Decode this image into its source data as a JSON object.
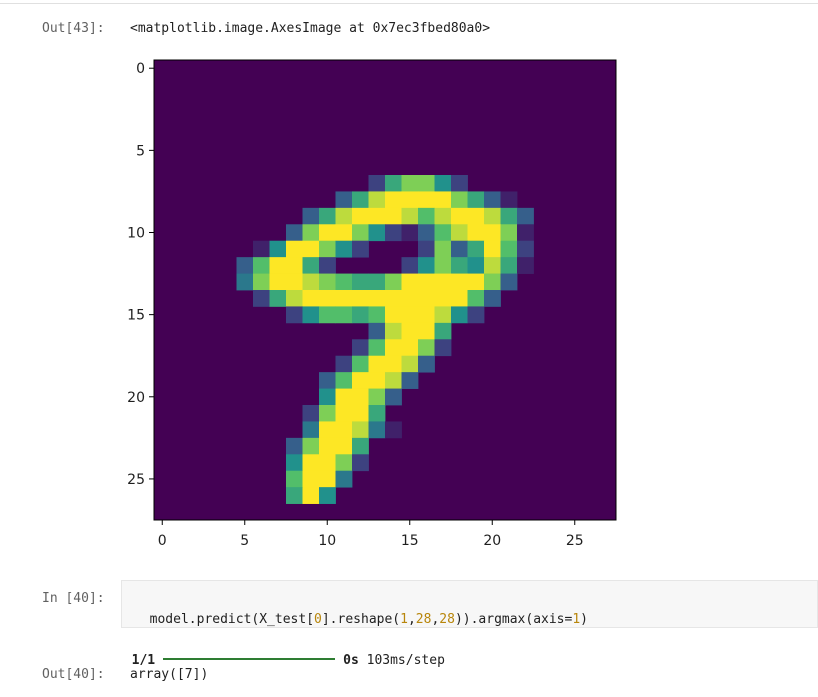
{
  "out43": {
    "prompt": "Out[43]:",
    "text": "<matplotlib.image.AxesImage at 0x7ec3fbed80a0>"
  },
  "chart_data": {
    "type": "heatmap",
    "title": "",
    "xlabel": "",
    "ylabel": "",
    "xlim": [
      -0.5,
      27.5
    ],
    "ylim": [
      27.5,
      -0.5
    ],
    "x_ticks": [
      "0",
      "5",
      "10",
      "15",
      "20",
      "25"
    ],
    "y_ticks": [
      "0",
      "5",
      "10",
      "15",
      "20",
      "25"
    ],
    "colormap": "viridis",
    "background_color": "#440154",
    "digit_pixels": [
      [
        7,
        13,
        0.2
      ],
      [
        7,
        14,
        0.6
      ],
      [
        7,
        15,
        0.8
      ],
      [
        7,
        16,
        0.8
      ],
      [
        7,
        17,
        0.5
      ],
      [
        7,
        18,
        0.2
      ],
      [
        8,
        11,
        0.3
      ],
      [
        8,
        12,
        0.6
      ],
      [
        8,
        13,
        0.9
      ],
      [
        8,
        14,
        1.0
      ],
      [
        8,
        15,
        1.0
      ],
      [
        8,
        16,
        1.0
      ],
      [
        8,
        17,
        1.0
      ],
      [
        8,
        18,
        0.8
      ],
      [
        8,
        19,
        0.6
      ],
      [
        8,
        20,
        0.3
      ],
      [
        8,
        21,
        0.1
      ],
      [
        9,
        9,
        0.3
      ],
      [
        9,
        10,
        0.6
      ],
      [
        9,
        11,
        0.9
      ],
      [
        9,
        12,
        1.0
      ],
      [
        9,
        13,
        1.0
      ],
      [
        9,
        14,
        1.0
      ],
      [
        9,
        15,
        0.9
      ],
      [
        9,
        16,
        0.7
      ],
      [
        9,
        17,
        0.9
      ],
      [
        9,
        18,
        1.0
      ],
      [
        9,
        19,
        1.0
      ],
      [
        9,
        20,
        0.9
      ],
      [
        9,
        21,
        0.6
      ],
      [
        9,
        22,
        0.3
      ],
      [
        10,
        8,
        0.3
      ],
      [
        10,
        9,
        0.8
      ],
      [
        10,
        10,
        1.0
      ],
      [
        10,
        11,
        1.0
      ],
      [
        10,
        12,
        0.8
      ],
      [
        10,
        13,
        0.5
      ],
      [
        10,
        14,
        0.2
      ],
      [
        10,
        15,
        0.1
      ],
      [
        10,
        16,
        0.3
      ],
      [
        10,
        17,
        0.7
      ],
      [
        10,
        18,
        0.9
      ],
      [
        10,
        19,
        1.0
      ],
      [
        10,
        20,
        1.0
      ],
      [
        10,
        21,
        0.8
      ],
      [
        10,
        22,
        0.1
      ],
      [
        11,
        6,
        0.1
      ],
      [
        11,
        7,
        0.5
      ],
      [
        11,
        8,
        1.0
      ],
      [
        11,
        9,
        1.0
      ],
      [
        11,
        10,
        0.8
      ],
      [
        11,
        11,
        0.5
      ],
      [
        11,
        12,
        0.2
      ],
      [
        11,
        16,
        0.2
      ],
      [
        11,
        17,
        0.8
      ],
      [
        11,
        18,
        0.3
      ],
      [
        11,
        19,
        0.6
      ],
      [
        11,
        20,
        1.0
      ],
      [
        11,
        21,
        0.7
      ],
      [
        11,
        22,
        0.2
      ],
      [
        12,
        5,
        0.3
      ],
      [
        12,
        6,
        0.7
      ],
      [
        12,
        7,
        1.0
      ],
      [
        12,
        8,
        1.0
      ],
      [
        12,
        9,
        0.6
      ],
      [
        12,
        10,
        0.2
      ],
      [
        12,
        15,
        0.2
      ],
      [
        12,
        16,
        0.5
      ],
      [
        12,
        17,
        0.8
      ],
      [
        12,
        18,
        0.6
      ],
      [
        12,
        19,
        0.5
      ],
      [
        12,
        20,
        0.9
      ],
      [
        12,
        21,
        0.6
      ],
      [
        12,
        22,
        0.1
      ],
      [
        13,
        5,
        0.4
      ],
      [
        13,
        6,
        0.8
      ],
      [
        13,
        7,
        1.0
      ],
      [
        13,
        8,
        1.0
      ],
      [
        13,
        9,
        0.9
      ],
      [
        13,
        10,
        0.8
      ],
      [
        13,
        11,
        0.7
      ],
      [
        13,
        12,
        0.6
      ],
      [
        13,
        13,
        0.6
      ],
      [
        13,
        14,
        0.8
      ],
      [
        13,
        15,
        1.0
      ],
      [
        13,
        16,
        1.0
      ],
      [
        13,
        17,
        1.0
      ],
      [
        13,
        18,
        1.0
      ],
      [
        13,
        19,
        1.0
      ],
      [
        13,
        20,
        0.8
      ],
      [
        13,
        21,
        0.3
      ],
      [
        14,
        6,
        0.2
      ],
      [
        14,
        7,
        0.6
      ],
      [
        14,
        8,
        0.9
      ],
      [
        14,
        9,
        1.0
      ],
      [
        14,
        10,
        1.0
      ],
      [
        14,
        11,
        1.0
      ],
      [
        14,
        12,
        1.0
      ],
      [
        14,
        13,
        1.0
      ],
      [
        14,
        14,
        1.0
      ],
      [
        14,
        15,
        1.0
      ],
      [
        14,
        16,
        1.0
      ],
      [
        14,
        17,
        1.0
      ],
      [
        14,
        18,
        1.0
      ],
      [
        14,
        19,
        0.7
      ],
      [
        14,
        20,
        0.3
      ],
      [
        15,
        8,
        0.2
      ],
      [
        15,
        9,
        0.5
      ],
      [
        15,
        10,
        0.7
      ],
      [
        15,
        11,
        0.7
      ],
      [
        15,
        12,
        0.6
      ],
      [
        15,
        13,
        0.7
      ],
      [
        15,
        14,
        1.0
      ],
      [
        15,
        15,
        1.0
      ],
      [
        15,
        16,
        1.0
      ],
      [
        15,
        17,
        0.9
      ],
      [
        15,
        18,
        0.5
      ],
      [
        15,
        19,
        0.2
      ],
      [
        16,
        13,
        0.3
      ],
      [
        16,
        14,
        0.9
      ],
      [
        16,
        15,
        1.0
      ],
      [
        16,
        16,
        1.0
      ],
      [
        16,
        17,
        0.6
      ],
      [
        17,
        12,
        0.2
      ],
      [
        17,
        13,
        0.7
      ],
      [
        17,
        14,
        1.0
      ],
      [
        17,
        15,
        1.0
      ],
      [
        17,
        16,
        0.8
      ],
      [
        17,
        17,
        0.2
      ],
      [
        18,
        11,
        0.2
      ],
      [
        18,
        12,
        0.7
      ],
      [
        18,
        13,
        1.0
      ],
      [
        18,
        14,
        1.0
      ],
      [
        18,
        15,
        0.9
      ],
      [
        18,
        16,
        0.3
      ],
      [
        19,
        10,
        0.3
      ],
      [
        19,
        11,
        0.7
      ],
      [
        19,
        12,
        1.0
      ],
      [
        19,
        13,
        1.0
      ],
      [
        19,
        14,
        0.9
      ],
      [
        19,
        15,
        0.3
      ],
      [
        20,
        10,
        0.5
      ],
      [
        20,
        11,
        1.0
      ],
      [
        20,
        12,
        1.0
      ],
      [
        20,
        13,
        0.8
      ],
      [
        20,
        14,
        0.3
      ],
      [
        21,
        9,
        0.2
      ],
      [
        21,
        10,
        0.8
      ],
      [
        21,
        11,
        1.0
      ],
      [
        21,
        12,
        1.0
      ],
      [
        21,
        13,
        0.6
      ],
      [
        22,
        9,
        0.4
      ],
      [
        22,
        10,
        1.0
      ],
      [
        22,
        11,
        1.0
      ],
      [
        22,
        12,
        0.9
      ],
      [
        22,
        13,
        0.4
      ],
      [
        22,
        14,
        0.1
      ],
      [
        23,
        8,
        0.3
      ],
      [
        23,
        9,
        0.8
      ],
      [
        23,
        10,
        1.0
      ],
      [
        23,
        11,
        1.0
      ],
      [
        23,
        12,
        0.6
      ],
      [
        24,
        8,
        0.5
      ],
      [
        24,
        9,
        1.0
      ],
      [
        24,
        10,
        1.0
      ],
      [
        24,
        11,
        0.8
      ],
      [
        24,
        12,
        0.2
      ],
      [
        25,
        8,
        0.7
      ],
      [
        25,
        9,
        1.0
      ],
      [
        25,
        10,
        1.0
      ],
      [
        25,
        11,
        0.4
      ],
      [
        26,
        8,
        0.6
      ],
      [
        26,
        9,
        1.0
      ],
      [
        26,
        10,
        0.5
      ]
    ]
  },
  "in40": {
    "prompt": "In [40]:",
    "code_parts": [
      "model.predict(X_test[",
      "0",
      "].reshape(",
      "1",
      ",",
      "28",
      ",",
      "28",
      ")).argmax(axis=",
      "1",
      ")"
    ]
  },
  "progress": {
    "count": "1/1",
    "fraction": 1.0,
    "time": "0s",
    "rate": "103ms/step"
  },
  "out40": {
    "prompt": "Out[40]:",
    "text": "array([7])"
  }
}
